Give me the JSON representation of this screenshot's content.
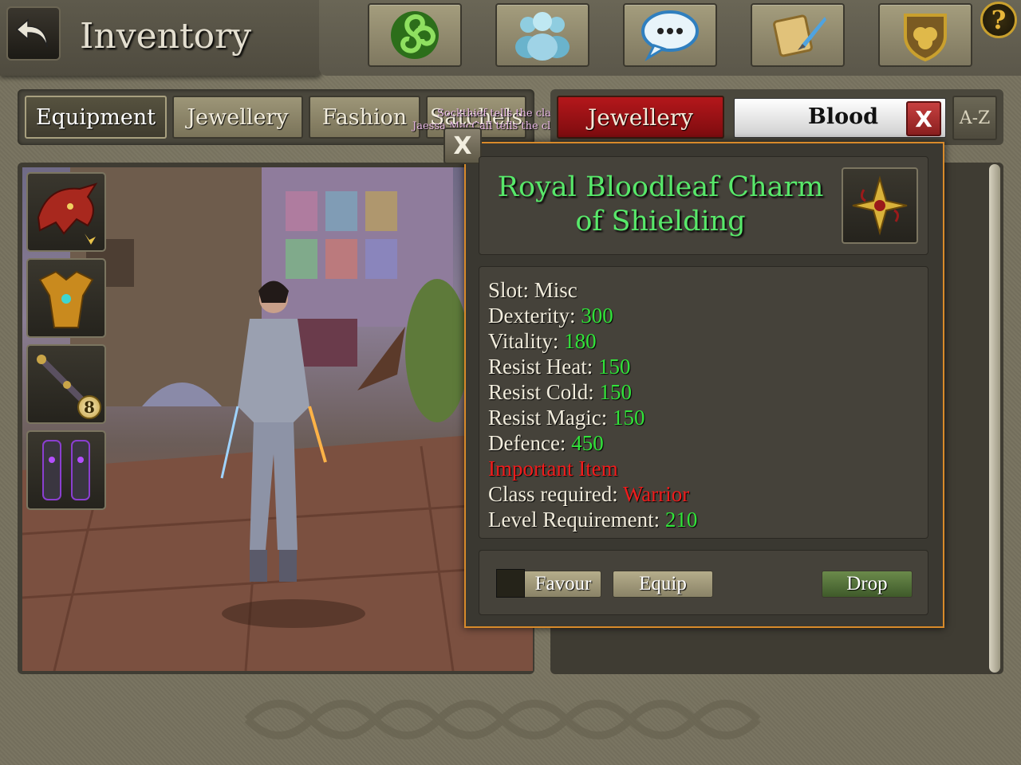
{
  "header": {
    "title": "Inventory"
  },
  "top_icons": [
    {
      "name": "triskele-icon",
      "color": "#3fae2a"
    },
    {
      "name": "group-icon",
      "color": "#9fd3e6"
    },
    {
      "name": "chat-bubble-icon",
      "color": "#4fa3e0"
    },
    {
      "name": "quest-scroll-icon",
      "color": "#d9b25a"
    },
    {
      "name": "clan-shield-icon",
      "color": "#c9a02e"
    }
  ],
  "help": {
    "label": "?"
  },
  "tabs": [
    {
      "label": "Equipment",
      "active": true
    },
    {
      "label": "Jewellery",
      "active": false
    },
    {
      "label": "Fashion",
      "active": false
    },
    {
      "label": "Satchels",
      "active": false
    }
  ],
  "chat": [
    {
      "text": "Sockthief tells the clan: lol"
    },
    {
      "text": "Jaessa MacCall tells the clan: where"
    }
  ],
  "filter": {
    "category": "Jewellery",
    "search_value": "Blood",
    "clear_label": "X",
    "sort_label": "A-Z"
  },
  "equipment_slots": [
    {
      "name": "dragon-helm-icon",
      "badge": ""
    },
    {
      "name": "chest-armour-icon",
      "badge": ""
    },
    {
      "name": "staff-weapon-icon",
      "badge": "8"
    },
    {
      "name": "greaves-icon",
      "badge": ""
    }
  ],
  "popup": {
    "close_label": "X",
    "item_name_line1": "Royal Bloodleaf Charm",
    "item_name_line2": "of Shielding",
    "stats": [
      {
        "label": "Slot: Misc",
        "value": ""
      },
      {
        "label": "Dexterity: ",
        "value": "300"
      },
      {
        "label": "Vitality: ",
        "value": "180"
      },
      {
        "label": "Resist Heat: ",
        "value": "150"
      },
      {
        "label": "Resist Cold: ",
        "value": "150"
      },
      {
        "label": "Resist Magic: ",
        "value": "150"
      },
      {
        "label": "Defence: ",
        "value": "450"
      }
    ],
    "important": "Important Item",
    "class_label": "Class required: ",
    "class_value": "Warrior",
    "level_label": "Level Requirement:  ",
    "level_value": "210",
    "favour_label": "Favour",
    "equip_label": "Equip",
    "drop_label": "Drop"
  }
}
